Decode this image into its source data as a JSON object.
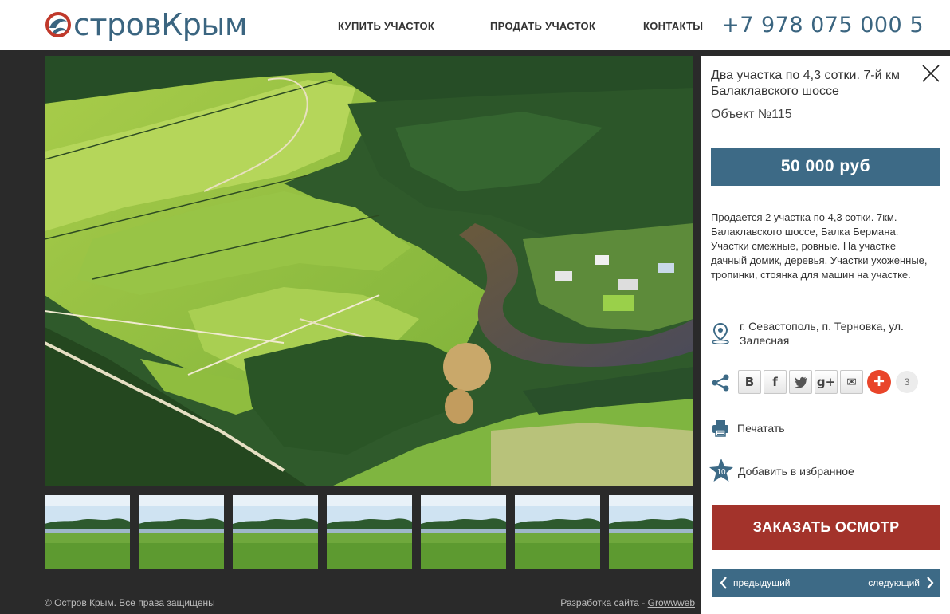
{
  "header": {
    "logo_text": "стровКрым",
    "nav": [
      "КУПИТЬ УЧАСТОК",
      "ПРОДАТЬ УЧАСТОК",
      "КОНТАКТЫ"
    ],
    "phone": "+7 978 075 000 5"
  },
  "listing": {
    "title": "Два участка по 4,3 сотки. 7-й км Балаклавского шоссе",
    "object_number": "Объект №115",
    "price": "50 000 руб",
    "description": "Продается 2 участка по 4,3 сотки. 7км. Балаклавского шоссе, Балка Бермана. Участки смежные, ровные. На участке дачный домик, деревья. Участки ухоженные, тропинки, стоянка для машин на участке.",
    "address": "г. Севастополь, п. Терновка, ул. Залесная"
  },
  "share": {
    "buttons": [
      "В",
      "f",
      "t",
      "g+",
      "✉"
    ],
    "count": "3"
  },
  "actions": {
    "print": "Печатать",
    "favorite": "Добавить в избранное",
    "favorite_count": "10",
    "order": "ЗАКАЗАТЬ ОСМОТР",
    "prev": "предыдущий",
    "next": "следующий"
  },
  "footer": {
    "copyright": "© Остров Крым. Все права защищены",
    "dev_prefix": "Разработка сайта - ",
    "dev_link": "Growwweb"
  },
  "thumbnail_count": 7,
  "colors": {
    "brand_blue": "#3d6a86",
    "order_red": "#a3332b",
    "plus_orange": "#e9452a"
  },
  "icons": [
    "logo-dolphin-icon",
    "close-icon",
    "location-pin-icon",
    "share-icon",
    "print-icon",
    "star-icon",
    "chevron-left-icon",
    "chevron-right-icon"
  ]
}
